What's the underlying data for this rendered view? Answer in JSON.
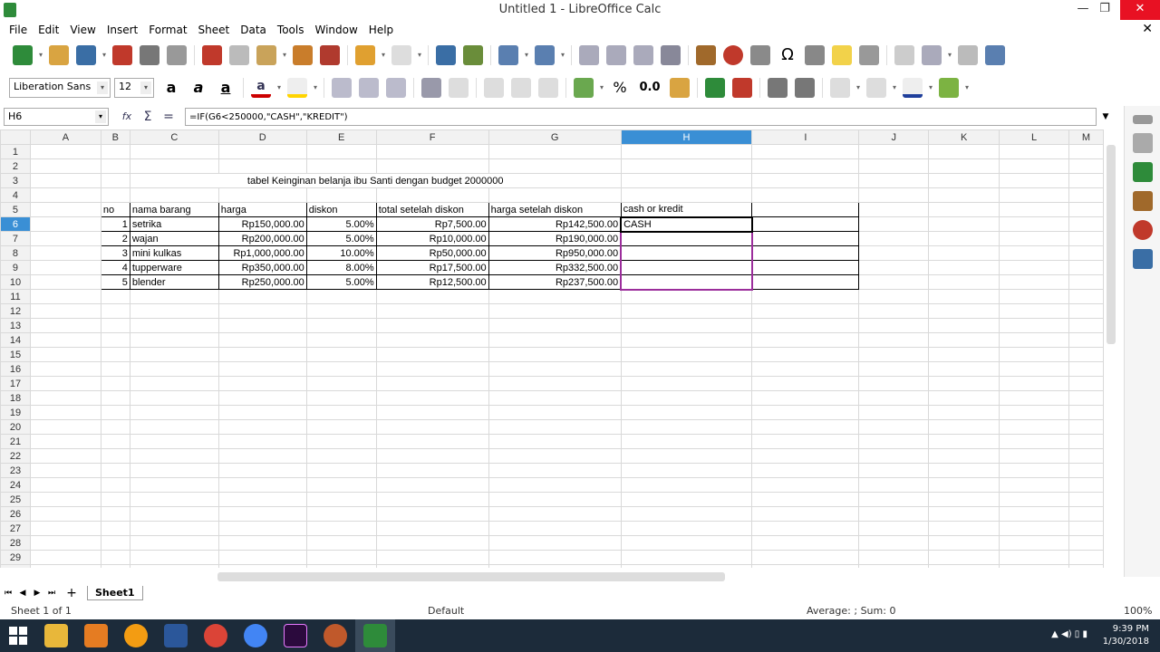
{
  "window": {
    "title": "Untitled 1 - LibreOffice Calc",
    "minimize": "—",
    "restore": "❐",
    "close": "✕",
    "menu_close": "✕"
  },
  "menu": [
    "File",
    "Edit",
    "View",
    "Insert",
    "Format",
    "Sheet",
    "Data",
    "Tools",
    "Window",
    "Help"
  ],
  "formatting": {
    "font_name": "Liberation Sans",
    "font_size": "12",
    "percent_label": "%",
    "decimal_label": "0.0"
  },
  "formula": {
    "cell_ref": "H6",
    "value": "=IF(G6<250000,\"CASH\",\"KREDIT\")",
    "fx_label": "fx",
    "sum_label": "Σ",
    "equals_label": "="
  },
  "columns": [
    "",
    "A",
    "B",
    "C",
    "D",
    "E",
    "F",
    "G",
    "H",
    "I",
    "J",
    "K",
    "L",
    "M"
  ],
  "selected_column": "H",
  "selected_row": 6,
  "sheet": {
    "title": "tabel  Keinginan belanja ibu Santi dengan budget 2000000",
    "headers": [
      "no",
      "nama barang",
      "harga",
      "diskon",
      "total setelah diskon",
      "harga setelah diskon",
      "cash or kredit"
    ],
    "rows": [
      [
        "1",
        "setrika",
        "Rp150,000.00",
        "5.00%",
        "Rp7,500.00",
        "Rp142,500.00",
        "CASH"
      ],
      [
        "2",
        "wajan",
        "Rp200,000.00",
        "5.00%",
        "Rp10,000.00",
        "Rp190,000.00",
        ""
      ],
      [
        "3",
        "mini kulkas",
        "Rp1,000,000.00",
        "10.00%",
        "Rp50,000.00",
        "Rp950,000.00",
        ""
      ],
      [
        "4",
        "tupperware",
        "Rp350,000.00",
        "8.00%",
        "Rp17,500.00",
        "Rp332,500.00",
        ""
      ],
      [
        "5",
        "blender",
        "Rp250,000.00",
        "5.00%",
        "Rp12,500.00",
        "Rp237,500.00",
        ""
      ]
    ]
  },
  "tabs": {
    "add": "+",
    "sheet1": "Sheet1"
  },
  "status": {
    "sheet_info": "Sheet 1 of 1",
    "page_style": "Default",
    "summary": "Average: ; Sum: 0",
    "zoom": "100%"
  },
  "taskbar": {
    "time": "9:39 PM",
    "date": "1/30/2018"
  },
  "colors": {
    "selection": "#3a8fd5",
    "border": "#d9d9d9",
    "highlight_border": "#9b2d9b",
    "taskbar": "#1c2b3a"
  }
}
